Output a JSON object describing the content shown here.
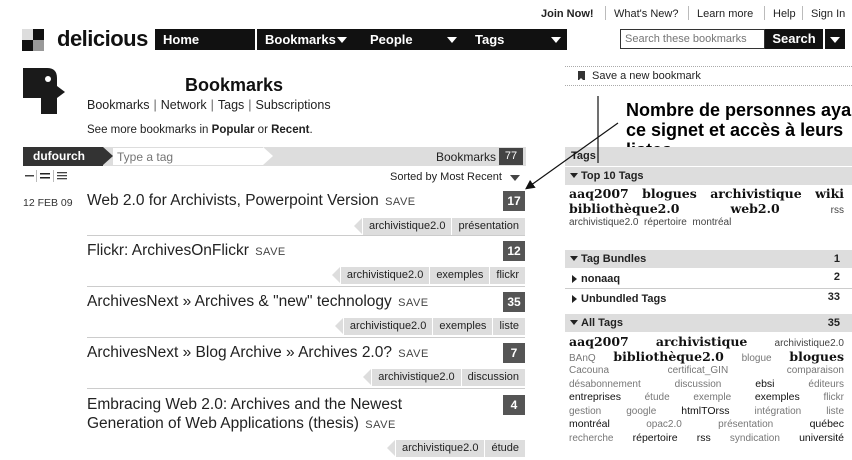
{
  "utility_nav": {
    "join": "Join Now!",
    "whats_new": "What's New?",
    "learn_more": "Learn more",
    "help": "Help",
    "sign_in": "Sign In"
  },
  "header": {
    "logo": "delicious",
    "tabs": [
      {
        "label": "Home"
      },
      {
        "label": "Bookmarks"
      },
      {
        "label": "People"
      },
      {
        "label": "Tags"
      }
    ],
    "search_placeholder": "Search these bookmarks",
    "search_button": "Search"
  },
  "profile": {
    "title": "Bookmarks",
    "subnav": [
      "Bookmarks",
      "Network",
      "Tags",
      "Subscriptions"
    ],
    "see_more_prefix": "See more bookmarks in",
    "popular": "Popular",
    "or": "or",
    "recent": "Recent"
  },
  "filter": {
    "user": "dufourch",
    "tag_placeholder": "Type a tag",
    "bookmarks_label": "Bookmarks",
    "bookmarks_count": "77",
    "sorted_by": "Sorted by",
    "sort_value": "Most Recent"
  },
  "date_label": "12 FEB 09",
  "save_label": "SAVE",
  "bookmarks": [
    {
      "title": "Web 2.0 for Archivists, Powerpoint Version",
      "count": "17",
      "tags": [
        "archivistique2.0",
        "présentation"
      ]
    },
    {
      "title": "Flickr: ArchivesOnFlickr",
      "count": "12",
      "tags": [
        "archivistique2.0",
        "exemples",
        "flickr"
      ]
    },
    {
      "title": "ArchivesNext » Archives & \"new\" technology",
      "count": "35",
      "tags": [
        "archivistique2.0",
        "exemples",
        "liste"
      ]
    },
    {
      "title": "ArchivesNext » Blog Archive » Archives 2.0?",
      "count": "7",
      "tags": [
        "archivistique2.0",
        "discussion"
      ]
    },
    {
      "title_line1": "Embracing Web 2.0: Archives and the Newest",
      "title_line2": "Generation of Web Applications (thesis)",
      "count": "4",
      "tags": [
        "archivistique2.0",
        "étude"
      ]
    }
  ],
  "right_panel": {
    "save_new": "Save a new bookmark",
    "annotation_lines": [
      "Nombre de personnes ayant",
      "ce signet et accès à leurs",
      "listes"
    ],
    "tags_header": "Tags",
    "top10_label": "Top 10 Tags",
    "top10": {
      "bold": [
        "aaq2007",
        "blogues",
        "archivistique",
        "wiki",
        "bibliothèque2.0",
        "web2.0"
      ],
      "normal": [
        "rss",
        "archivistique2.0",
        "répertoire",
        "montréal"
      ]
    },
    "bundles_label": "Tag Bundles",
    "bundles_count": "1",
    "bundle_items": [
      {
        "name": "nonaaq",
        "count": "2"
      },
      {
        "name": "Unbundled Tags",
        "count": "33"
      }
    ],
    "all_tags_label": "All Tags",
    "all_tags_count": "35",
    "all_tags": {
      "line1": [
        "aaq2007",
        "archivistique",
        "archivistique2.0"
      ],
      "line2": [
        "BAnQ",
        "bibliothèque2.0",
        "blogue",
        "blogues"
      ],
      "line3": [
        "Cacouna",
        "certificat_GIN",
        "comparaison"
      ],
      "line4": [
        "désabonnement",
        "discussion",
        "ebsi",
        "éditeurs"
      ],
      "line5": [
        "entreprises",
        "étude",
        "exemple",
        "exemples",
        "flickr"
      ],
      "line6": [
        "gestion",
        "google",
        "htmlTOrss",
        "intégration",
        "liste"
      ],
      "line7": [
        "montréal",
        "opac2.0",
        "présentation",
        "québec"
      ],
      "line8": [
        "recherche",
        "répertoire",
        "rss",
        "syndication",
        "université"
      ]
    }
  }
}
